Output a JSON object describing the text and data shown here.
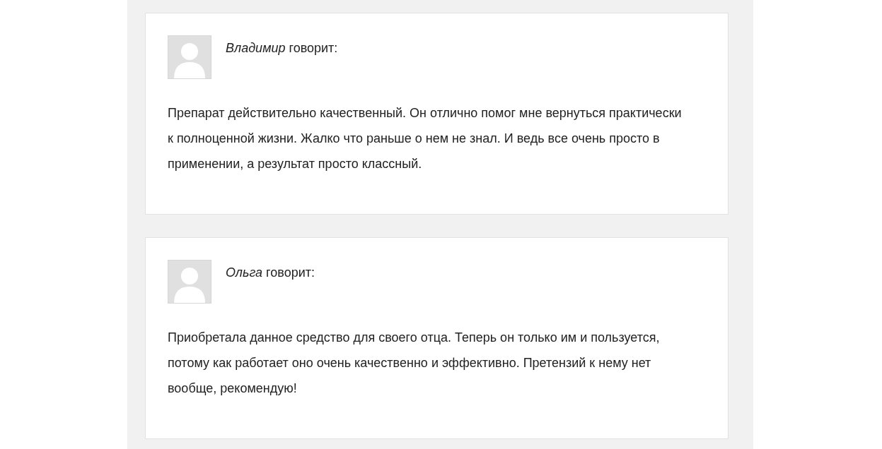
{
  "comments": [
    {
      "author": "*Владимир* говорит:",
      "text": "Препарат действительно качественный. Он отлично помог мне вернуться практически к полноценной жизни. Жалко что раньше о нем не знал. И ведь все очень просто в применении, а результат просто классный."
    },
    {
      "author": "*Ольга* говорит:",
      "text": "Приобретала данное средство для своего отца. Теперь он только им и пользуется, потому как работает оно очень качественно и эффективно. Претензий к нему нет вообще, рекомендую!"
    }
  ]
}
